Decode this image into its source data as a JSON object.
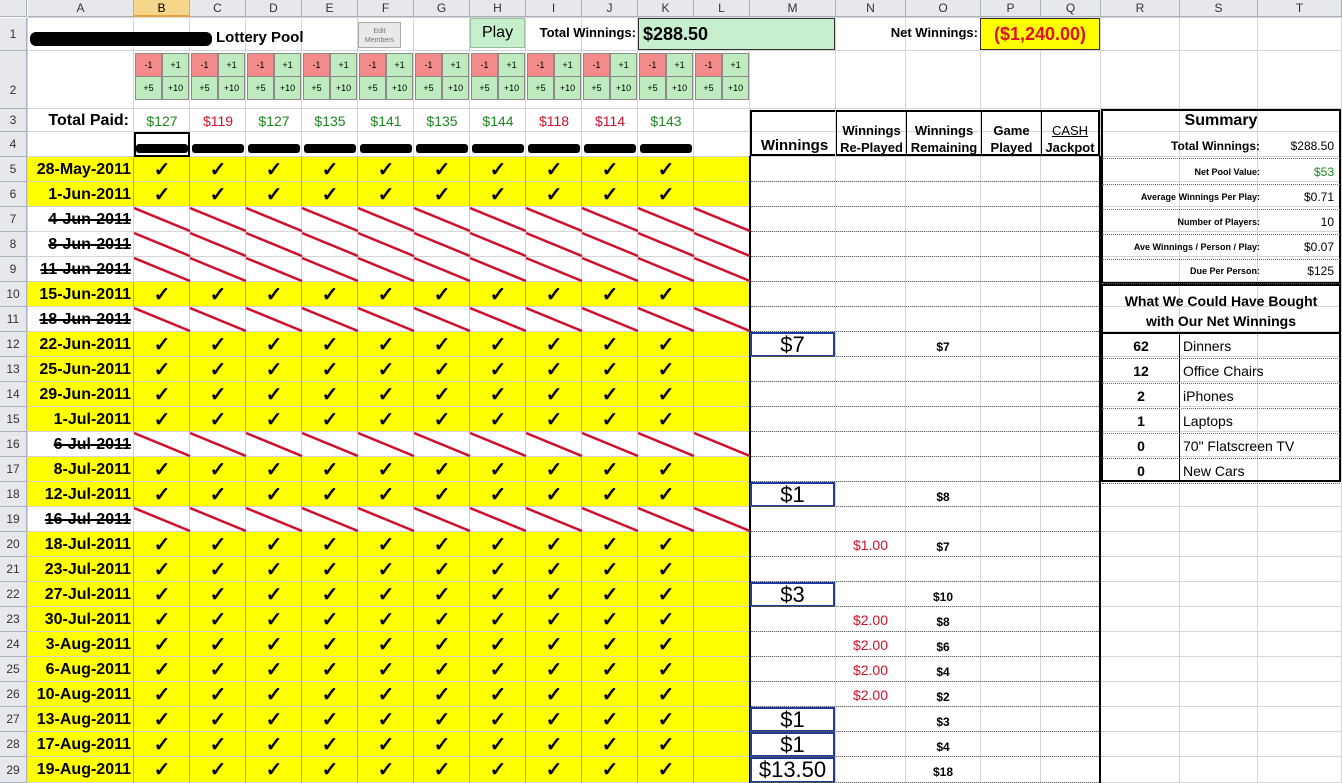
{
  "columns": [
    "A",
    "B",
    "C",
    "D",
    "E",
    "F",
    "G",
    "H",
    "I",
    "J",
    "K",
    "L",
    "M",
    "N",
    "O",
    "P",
    "Q",
    "R",
    "S",
    "T"
  ],
  "selected_column": "B",
  "rows": [
    "1",
    "2",
    "3",
    "4",
    "5",
    "6",
    "7",
    "8",
    "9",
    "10",
    "11",
    "12",
    "13",
    "14",
    "15",
    "16",
    "17",
    "18",
    "19",
    "20",
    "21",
    "22",
    "23",
    "24",
    "25",
    "26",
    "27",
    "28",
    "29"
  ],
  "title": "Lottery Pool",
  "edit_members_label": "Edit Members",
  "play_label": "Play",
  "total_winnings_label": "Total Winnings:",
  "total_winnings_value": "$288.50",
  "net_winnings_label": "Net Winnings:",
  "net_winnings_value": "($1,240.00)",
  "total_paid_label": "Total Paid:",
  "adjust_labels": {
    "minus1": "-1",
    "plus1": "+1",
    "plus5": "+5",
    "plus10": "+10"
  },
  "paid_values": [
    {
      "value": "$127",
      "color": "#1e8a1e"
    },
    {
      "value": "$119",
      "color": "#d0102b"
    },
    {
      "value": "$127",
      "color": "#1e8a1e"
    },
    {
      "value": "$135",
      "color": "#1e8a1e"
    },
    {
      "value": "$141",
      "color": "#1e8a1e"
    },
    {
      "value": "$135",
      "color": "#1e8a1e"
    },
    {
      "value": "$144",
      "color": "#1e8a1e"
    },
    {
      "value": "$118",
      "color": "#d0102b"
    },
    {
      "value": "$114",
      "color": "#d0102b"
    },
    {
      "value": "$143",
      "color": "#1e8a1e"
    }
  ],
  "headers": {
    "winnings": "Winnings",
    "replayed_line1": "Winnings",
    "replayed_line2": "Re-Played",
    "remaining_line1": "Winnings",
    "remaining_line2": "Remaining",
    "game_line1": "Game",
    "game_line2": "Played",
    "cash_line1": "CASH",
    "cash_line2": "Jackpot"
  },
  "check_glyph": "✓",
  "draws": [
    {
      "date": "28-May-2011",
      "played": true,
      "winnings": "",
      "replayed": "",
      "remaining": ""
    },
    {
      "date": "1-Jun-2011",
      "played": true,
      "winnings": "",
      "replayed": "",
      "remaining": ""
    },
    {
      "date": "4-Jun-2011",
      "played": false,
      "winnings": "",
      "replayed": "",
      "remaining": ""
    },
    {
      "date": "8-Jun-2011",
      "played": false,
      "winnings": "",
      "replayed": "",
      "remaining": ""
    },
    {
      "date": "11-Jun-2011",
      "played": false,
      "winnings": "",
      "replayed": "",
      "remaining": ""
    },
    {
      "date": "15-Jun-2011",
      "played": true,
      "winnings": "",
      "replayed": "",
      "remaining": ""
    },
    {
      "date": "18-Jun-2011",
      "played": false,
      "winnings": "",
      "replayed": "",
      "remaining": ""
    },
    {
      "date": "22-Jun-2011",
      "played": true,
      "winnings": "$7",
      "replayed": "",
      "remaining": "$7"
    },
    {
      "date": "25-Jun-2011",
      "played": true,
      "winnings": "",
      "replayed": "",
      "remaining": ""
    },
    {
      "date": "29-Jun-2011",
      "played": true,
      "winnings": "",
      "replayed": "",
      "remaining": ""
    },
    {
      "date": "1-Jul-2011",
      "played": true,
      "winnings": "",
      "replayed": "",
      "remaining": ""
    },
    {
      "date": "6-Jul-2011",
      "played": false,
      "winnings": "",
      "replayed": "",
      "remaining": ""
    },
    {
      "date": "8-Jul-2011",
      "played": true,
      "winnings": "",
      "replayed": "",
      "remaining": ""
    },
    {
      "date": "12-Jul-2011",
      "played": true,
      "winnings": "$1",
      "replayed": "",
      "remaining": "$8"
    },
    {
      "date": "16-Jul-2011",
      "played": false,
      "winnings": "",
      "replayed": "",
      "remaining": ""
    },
    {
      "date": "18-Jul-2011",
      "played": true,
      "winnings": "",
      "replayed": "$1.00",
      "remaining": "$7"
    },
    {
      "date": "23-Jul-2011",
      "played": true,
      "winnings": "",
      "replayed": "",
      "remaining": ""
    },
    {
      "date": "27-Jul-2011",
      "played": true,
      "winnings": "$3",
      "replayed": "",
      "remaining": "$10"
    },
    {
      "date": "30-Jul-2011",
      "played": true,
      "winnings": "",
      "replayed": "$2.00",
      "remaining": "$8"
    },
    {
      "date": "3-Aug-2011",
      "played": true,
      "winnings": "",
      "replayed": "$2.00",
      "remaining": "$6"
    },
    {
      "date": "6-Aug-2011",
      "played": true,
      "winnings": "",
      "replayed": "$2.00",
      "remaining": "$4"
    },
    {
      "date": "10-Aug-2011",
      "played": true,
      "winnings": "",
      "replayed": "$2.00",
      "remaining": "$2"
    },
    {
      "date": "13-Aug-2011",
      "played": true,
      "winnings": "$1",
      "replayed": "",
      "remaining": "$3"
    },
    {
      "date": "17-Aug-2011",
      "played": true,
      "winnings": "$1",
      "replayed": "",
      "remaining": "$4"
    },
    {
      "date": "19-Aug-2011",
      "played": true,
      "winnings": "$13.50",
      "replayed": "",
      "remaining": "$18"
    }
  ],
  "summary": {
    "title": "Summary",
    "rows": [
      {
        "label": "Total Winnings:",
        "value": "$288.50",
        "color": "#000000"
      },
      {
        "label": "Net Pool Value:",
        "value": "$53",
        "color": "#1e8a1e"
      },
      {
        "label": "Average Winnings Per Play:",
        "value": "$0.71",
        "color": "#000000"
      },
      {
        "label": "Number of Players:",
        "value": "10",
        "color": "#000000"
      },
      {
        "label": "Ave Winnings / Person / Play:",
        "value": "$0.07",
        "color": "#000000"
      },
      {
        "label": "Due Per Person:",
        "value": "$125",
        "color": "#000000"
      }
    ]
  },
  "could_have_bought": {
    "title_line1": "What We Could Have Bought",
    "title_line2": "with Our Net Winnings",
    "items": [
      {
        "count": "62",
        "name": "Dinners"
      },
      {
        "count": "12",
        "name": "Office Chairs"
      },
      {
        "count": "2",
        "name": "iPhones"
      },
      {
        "count": "1",
        "name": "Laptops"
      },
      {
        "count": "0",
        "name": "70\" Flatscreen TV"
      },
      {
        "count": "0",
        "name": "New Cars"
      }
    ]
  },
  "colors": {
    "highlight": "#ffff00",
    "strike": "#d0102b",
    "play_bg": "#c6efce",
    "total_bg": "#c6efce",
    "net_bg": "#ffff00",
    "win_border": "#1f3a9e"
  }
}
